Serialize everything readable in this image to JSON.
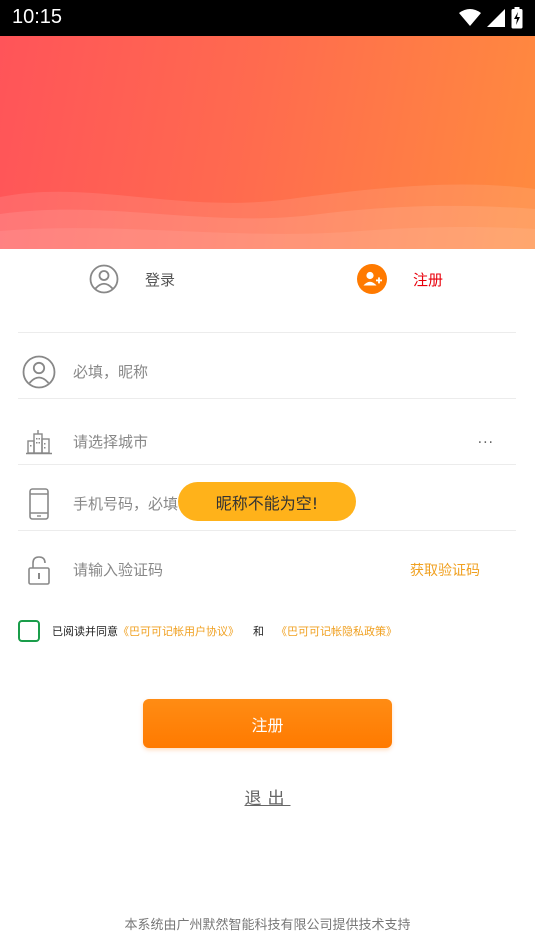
{
  "status_bar": {
    "time": "10:15"
  },
  "tabs": {
    "login": {
      "label": "登录"
    },
    "register": {
      "label": "注册"
    }
  },
  "form": {
    "nickname": {
      "placeholder": "必填，昵称"
    },
    "city": {
      "label": "请选择城市",
      "more": "..."
    },
    "phone": {
      "placeholder": "手机号码，必填"
    },
    "code": {
      "placeholder": "请输入验证码",
      "get_code_label": "获取验证码"
    }
  },
  "agreement": {
    "prefix": "已阅读并同意",
    "user_agreement": "《巴可可记帐用户协议》",
    "and": "和",
    "privacy_policy": "《巴可可记帐隐私政策》"
  },
  "submit_label": "注册",
  "exit_label": "退出",
  "toast": "昵称不能为空!",
  "footer": "本系统由广州默然智能科技有限公司提供技术支持",
  "colors": {
    "accent_orange": "#ff7a00",
    "link_orange": "#f0a020",
    "active_red": "#e8000b",
    "banner_start": "#ff5459",
    "banner_end": "#ff8b3e",
    "toast_bg": "#ffb21a",
    "checkbox_green": "#1a9d4a"
  }
}
